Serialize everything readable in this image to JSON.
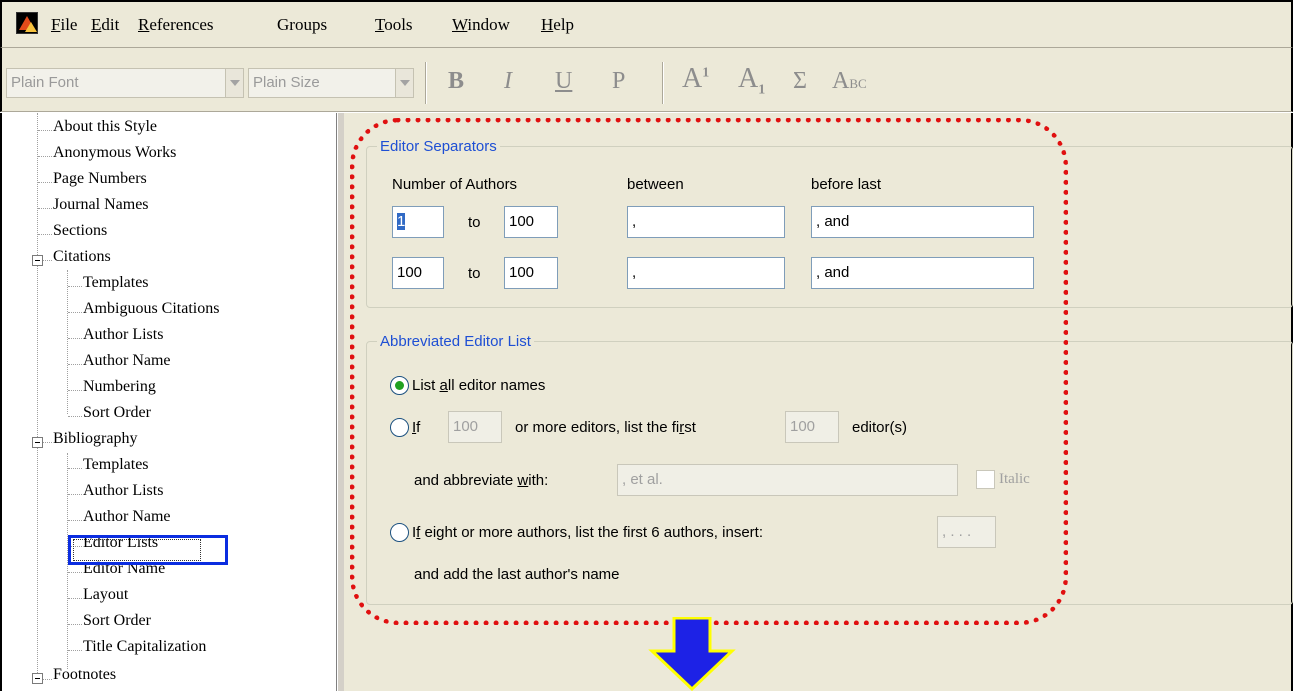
{
  "menubar": {
    "items": [
      {
        "prefix": "",
        "u": "F",
        "rest": "ile"
      },
      {
        "prefix": "",
        "u": "E",
        "rest": "dit"
      },
      {
        "prefix": "",
        "u": "R",
        "rest": "eferences"
      },
      {
        "prefix": "Groups",
        "u": "",
        "rest": ""
      },
      {
        "prefix": "",
        "u": "T",
        "rest": "ools"
      },
      {
        "prefix": "",
        "u": "W",
        "rest": "indow"
      },
      {
        "prefix": "",
        "u": "H",
        "rest": "elp"
      }
    ]
  },
  "toolbar": {
    "font_value": "Plain Font",
    "size_value": "Plain Size",
    "bold": "B",
    "italic": "I",
    "underline": "U",
    "plain": "P",
    "superscript_base": "A",
    "superscript_mark": "1",
    "subscript_base": "A",
    "subscript_mark": "1",
    "symbol": "Σ",
    "smallcaps_big": "A",
    "smallcaps_small": "BC"
  },
  "tree": {
    "items": [
      "About this Style",
      "Anonymous Works",
      "Page Numbers",
      "Journal Names",
      "Sections",
      "Citations",
      "Templates",
      "Ambiguous Citations",
      "Author Lists",
      "Author Name",
      "Numbering",
      "Sort Order",
      "Bibliography",
      "Templates",
      "Author Lists",
      "Author Name",
      "Editor Lists",
      "Editor Name",
      "Layout",
      "Sort Order",
      "Title Capitalization",
      "Footnotes"
    ],
    "selected": "Editor Lists"
  },
  "editor_separators": {
    "legend": "Editor Separators",
    "col_authors": "Number of Authors",
    "col_between": "between",
    "col_before_last": "before last",
    "to_label": "to",
    "rows": [
      {
        "from": "1",
        "to": "100",
        "between": ",",
        "before_last": ", and"
      },
      {
        "from": "100",
        "to": "100",
        "between": ",",
        "before_last": ", and"
      }
    ]
  },
  "abbreviated": {
    "legend": "Abbreviated Editor List",
    "opt1_a": "List ",
    "opt1_u": "a",
    "opt1_b": "ll editor names",
    "opt2_u": "I",
    "opt2_b": "f",
    "opt2_count": "100",
    "opt2_mid_a": "or more editors, list the fi",
    "opt2_mid_u": "r",
    "opt2_mid_b": "st",
    "opt2_first": "100",
    "opt2_end": "editor(s)",
    "abbrev_a": "and abbreviate ",
    "abbrev_u": "w",
    "abbrev_b": "ith:",
    "abbrev_value": ", et al.",
    "italic_label": "Italic",
    "opt3_a": "I",
    "opt3_u": "f",
    "opt3_b": " eight or more authors, list the first 6 authors, insert:",
    "opt3_value": ", . . .",
    "opt3_line2": "and add the last author's name",
    "selected": "list_all"
  },
  "colors": {
    "accent": "#1e4fd4",
    "highlight_frame": "#e01010",
    "selection_box": "#0b2de0",
    "arrow_fill": "#1d22e6",
    "arrow_outline": "#ffff00"
  }
}
